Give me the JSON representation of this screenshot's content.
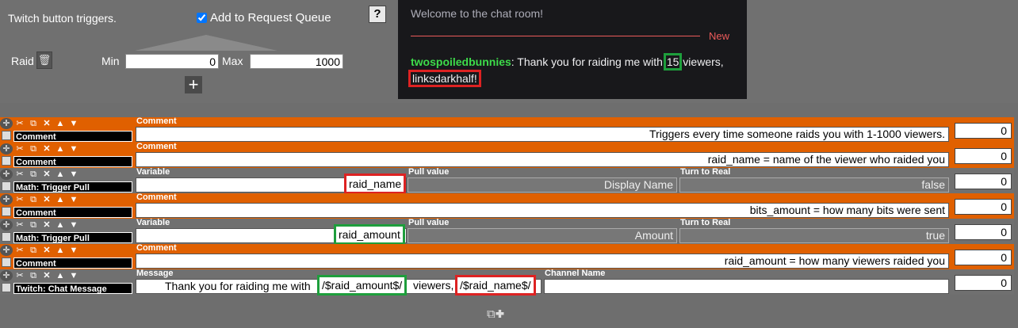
{
  "trigger_panel": {
    "title": "Twitch button triggers.",
    "queue_label": "Add to Request Queue",
    "queue_checked": true,
    "help": "?",
    "trigger_name": "Raid",
    "min_label": "Min",
    "min_value": "0",
    "max_label": "Max",
    "max_value": "1000",
    "add": "+"
  },
  "chat": {
    "welcome": "Welcome to the chat room!",
    "new_label": "New",
    "username": "twospoiledbunnies",
    "msg_a": ": Thank you for raiding me with ",
    "amount": "15",
    "msg_b": " viewers,",
    "raider": "linksdarkhalf!"
  },
  "rows": [
    {
      "type": "Comment",
      "label1": "Comment",
      "value1": "Triggers every time someone raids you with 1-1000 viewers.",
      "num": "0"
    },
    {
      "type": "Comment",
      "label1": "Comment",
      "value1": "raid_name = name of the viewer who raided you",
      "num": "0"
    },
    {
      "type": "Math: Trigger Pull",
      "label1": "Variable",
      "value1": "raid_name",
      "label2": "Pull value",
      "value2": "Display Name",
      "label3": "Turn to Real",
      "value3": "false",
      "num": "0"
    },
    {
      "type": "Comment",
      "label1": "Comment",
      "value1": "bits_amount = how many bits were sent",
      "num": "0"
    },
    {
      "type": "Math: Trigger Pull",
      "label1": "Variable",
      "value1": "raid_amount",
      "label2": "Pull value",
      "value2": "Amount",
      "label3": "Turn to Real",
      "value3": "true",
      "num": "0"
    },
    {
      "type": "Comment",
      "label1": "Comment",
      "value1": "raid_amount = how many viewers raided you",
      "num": "0"
    },
    {
      "type": "Twitch: Chat Message",
      "label1": "Message",
      "msg_a": "Thank you for raiding me with ",
      "msg_var1": "/$raid_amount$/",
      "msg_b": " viewers, ",
      "msg_var2": "/$raid_name$/",
      "label2": "Channel Name",
      "value2": "",
      "num": "0"
    }
  ],
  "colors": {
    "orange": "#e06000",
    "highlight_red": "#dd2222",
    "highlight_green": "#1e9e3c",
    "chat_user": "#3ddc4a"
  }
}
